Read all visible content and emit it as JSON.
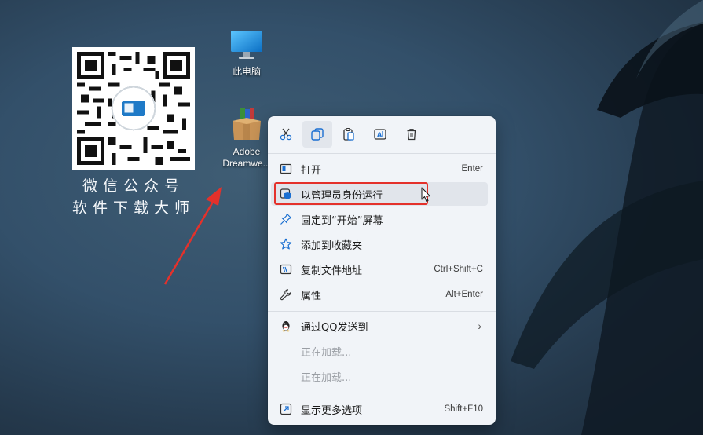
{
  "desktop": {
    "promo": {
      "line1": "微信公众号",
      "line2": "软件下载大师"
    },
    "icons": [
      {
        "label": "此电脑",
        "name": "this-pc"
      },
      {
        "label": "Adobe\nDreamwe...",
        "line1": "Adobe",
        "line2": "Dreamwe..."
      }
    ]
  },
  "menu": {
    "toolbar": [
      "cut-icon",
      "copy-icon",
      "paste-icon",
      "rename-icon",
      "delete-icon"
    ],
    "items": [
      {
        "label": "打开",
        "shortcut": "Enter",
        "icon": "open-icon"
      },
      {
        "label": "以管理员身份运行",
        "shortcut": "",
        "icon": "shield-icon"
      },
      {
        "label": "固定到“开始”屏幕",
        "shortcut": "",
        "icon": "pin-icon"
      },
      {
        "label": "添加到收藏夹",
        "shortcut": "",
        "icon": "star-icon"
      },
      {
        "label": "复制文件地址",
        "shortcut": "Ctrl+Shift+C",
        "icon": "copy-path-icon"
      },
      {
        "label": "属性",
        "shortcut": "Alt+Enter",
        "icon": "wrench-icon"
      },
      {
        "label": "通过QQ发送到",
        "shortcut": "",
        "icon": "qq-icon"
      },
      {
        "label": "正在加载...",
        "shortcut": ""
      },
      {
        "label": "正在加载...",
        "shortcut": ""
      },
      {
        "label": "显示更多选项",
        "shortcut": "Shift+F10",
        "icon": "more-options-icon"
      }
    ]
  },
  "colors": {
    "highlight": "#e4312b",
    "accent": "#1a6fd1",
    "menu_bg": "#f1f4f8"
  }
}
